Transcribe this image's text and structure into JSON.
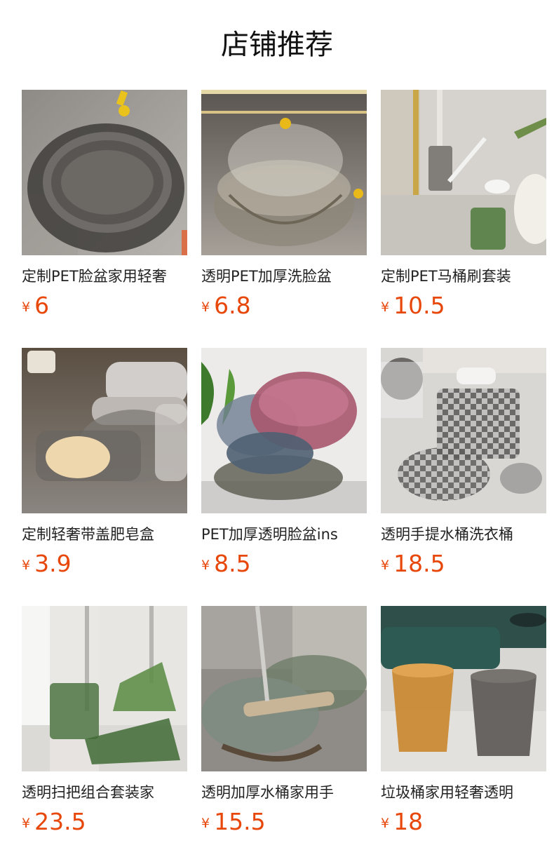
{
  "header": {
    "title": "店铺推荐"
  },
  "colors": {
    "price": "#e8470a",
    "title": "#111111",
    "text": "#222222"
  },
  "products": [
    {
      "name": "定制PET脸盆家用轻奢",
      "currency": "¥",
      "price": "6",
      "image_icon": "smoke-grey-basin-image"
    },
    {
      "name": "透明PET加厚洗脸盆",
      "currency": "¥",
      "price": "6.8",
      "image_icon": "stacked-clear-basins-image"
    },
    {
      "name": "定制PET马桶刷套装",
      "currency": "¥",
      "price": "10.5",
      "image_icon": "toilet-brush-set-image"
    },
    {
      "name": "定制轻奢带盖肥皂盒",
      "currency": "¥",
      "price": "3.9",
      "image_icon": "soap-box-image"
    },
    {
      "name": "PET加厚透明脸盆ins",
      "currency": "¥",
      "price": "8.5",
      "image_icon": "colored-basins-image"
    },
    {
      "name": "透明手提水桶洗衣桶",
      "currency": "¥",
      "price": "18.5",
      "image_icon": "checkered-bucket-image"
    },
    {
      "name": "透明扫把组合套装家",
      "currency": "¥",
      "price": "23.5",
      "image_icon": "broom-dustpan-image"
    },
    {
      "name": "透明加厚水桶家用手",
      "currency": "¥",
      "price": "15.5",
      "image_icon": "mop-bucket-image"
    },
    {
      "name": "垃圾桶家用轻奢透明",
      "currency": "¥",
      "price": "18",
      "image_icon": "trash-bins-image"
    }
  ]
}
